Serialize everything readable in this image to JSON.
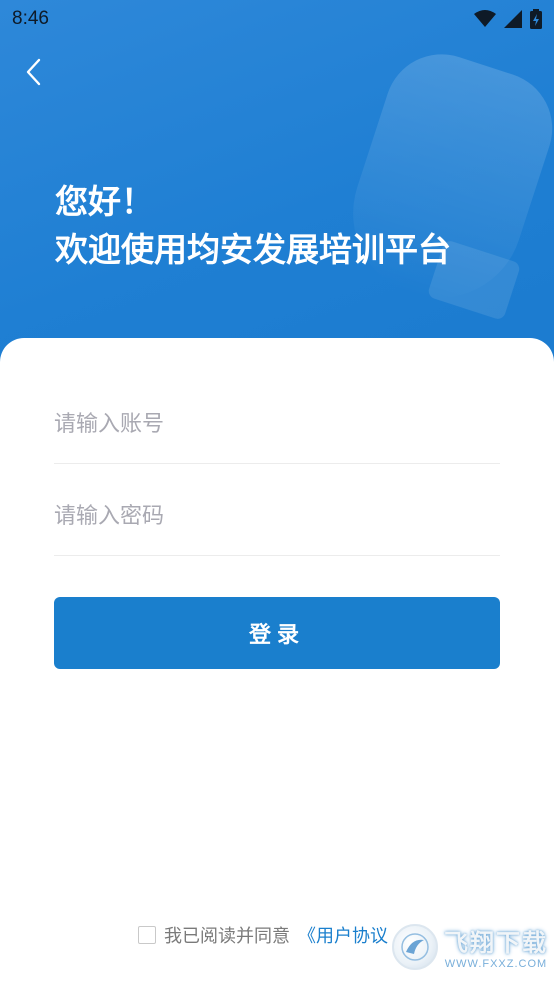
{
  "status_bar": {
    "time": "8:46"
  },
  "header": {
    "greeting_line1": "您好！",
    "greeting_line2": "欢迎使用均安发展培训平台"
  },
  "form": {
    "account_placeholder": "请输入账号",
    "password_placeholder": "请输入密码",
    "login_label": "登录"
  },
  "agreement": {
    "text": "我已阅读并同意",
    "link": "《用户协议"
  },
  "watermark": {
    "title": "飞翔下载",
    "url": "WWW.FXXZ.COM"
  },
  "colors": {
    "primary": "#1a7fcd",
    "header_bg": "#2e88d9"
  }
}
